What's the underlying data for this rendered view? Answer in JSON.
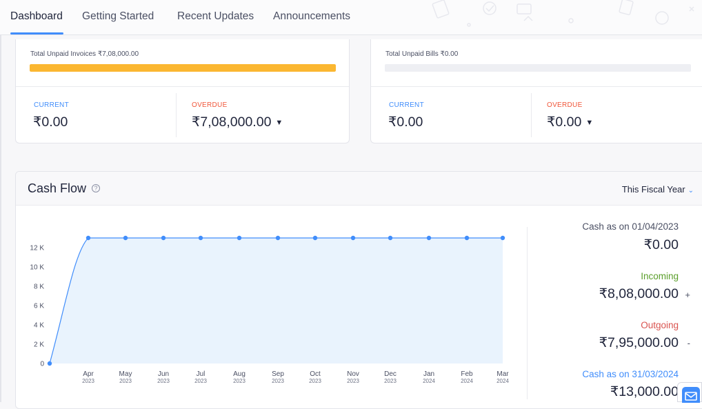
{
  "tabs": [
    {
      "label": "Dashboard",
      "active": true
    },
    {
      "label": "Getting Started",
      "active": false
    },
    {
      "label": "Recent Updates",
      "active": false
    },
    {
      "label": "Announcements",
      "active": false
    }
  ],
  "receivables": {
    "total_label": "Total Unpaid Invoices ₹7,08,000.00",
    "progress": 1.0,
    "current_label": "CURRENT",
    "current_value": "₹0.00",
    "overdue_label": "OVERDUE",
    "overdue_value": "₹7,08,000.00",
    "overdue_caret": "▼"
  },
  "payables": {
    "total_label": "Total Unpaid Bills ₹0.00",
    "progress": 0,
    "current_label": "CURRENT",
    "current_value": "₹0.00",
    "overdue_label": "OVERDUE",
    "overdue_value": "₹0.00",
    "overdue_caret": "▼"
  },
  "cash_flow": {
    "title": "Cash Flow",
    "help_icon": "?",
    "period": "This Fiscal Year",
    "period_icon": "chevron-down-icon",
    "summary": {
      "opening_label": "Cash as on 01/04/2023",
      "opening_value": "₹0.00",
      "incoming_label": "Incoming",
      "incoming_value": "₹8,08,000.00",
      "incoming_sign": "+",
      "outgoing_label": "Outgoing",
      "outgoing_value": "₹7,95,000.00",
      "outgoing_sign": "-",
      "closing_label": "Cash as on 31/03/2024",
      "closing_value": "₹13,000.00"
    }
  },
  "colors": {
    "accent": "#408dfb",
    "progress_fill": "#fbb731",
    "overdue": "#f0573a",
    "incoming": "#5a9e2a",
    "outgoing": "#d9534f",
    "area_fill": "#e9f3fd",
    "line": "#408dfb"
  },
  "chart_data": {
    "type": "area",
    "x": [
      "",
      "Apr",
      "May",
      "Jun",
      "Jul",
      "Aug",
      "Sep",
      "Oct",
      "Nov",
      "Dec",
      "Jan",
      "Feb",
      "Mar"
    ],
    "x_years": [
      "",
      "2023",
      "2023",
      "2023",
      "2023",
      "2023",
      "2023",
      "2023",
      "2023",
      "2023",
      "2024",
      "2024",
      "2024"
    ],
    "series": [
      {
        "values": [
          0,
          13000,
          13000,
          13000,
          13000,
          13000,
          13000,
          13000,
          13000,
          13000,
          13000,
          13000,
          13000
        ]
      }
    ],
    "yticks": [
      0,
      2000,
      4000,
      6000,
      8000,
      10000,
      12000
    ],
    "ytick_labels": [
      "0",
      "2 K",
      "4 K",
      "6 K",
      "8 K",
      "10 K",
      "12 K"
    ],
    "ylim": [
      0,
      13500
    ],
    "grid": false
  }
}
